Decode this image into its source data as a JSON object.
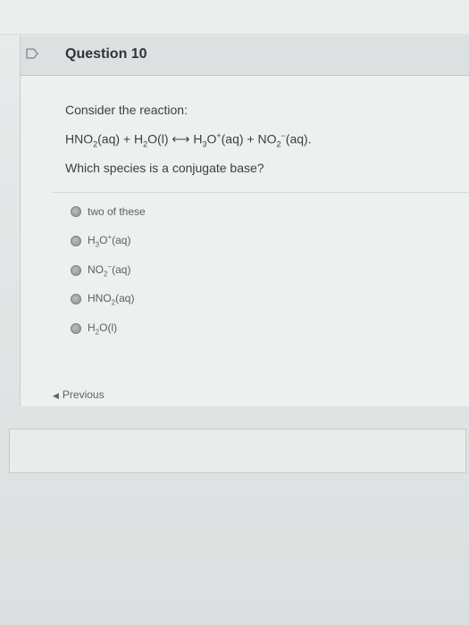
{
  "question": {
    "title": "Question 10",
    "prompt": "Consider the reaction:",
    "equation": {
      "r1": "HNO",
      "r1_sub": "2",
      "r1_state": "(aq)",
      "plus1": " + ",
      "r2a": "H",
      "r2_sub": "2",
      "r2b": "O(l)",
      "arrow": " ⟷ ",
      "p1a": "H",
      "p1_sub": "3",
      "p1b": "O",
      "p1_sup": "+",
      "p1_state": "(aq)",
      "plus2": " + ",
      "p2a": "NO",
      "p2_sub": "2",
      "p2_sup": "−",
      "p2_state": "(aq)."
    },
    "question_text": "Which species is a conjugate base?",
    "options": [
      {
        "label": "two of these"
      },
      {
        "a": "H",
        "sub": "3",
        "b": "O",
        "sup": "+",
        "state": "(aq)"
      },
      {
        "a": "NO",
        "sub": "2",
        "sup": "−",
        "state": "(aq)"
      },
      {
        "a": "HNO",
        "sub": "2",
        "state": "(aq)"
      },
      {
        "a": "H",
        "sub": "2",
        "b": "O(l)"
      }
    ]
  },
  "navigation": {
    "previous_label": "Previous",
    "previous_icon": "chevron-left-icon"
  },
  "colors": {
    "header_bg": "#dde0e0",
    "text": "#3a3f44"
  }
}
